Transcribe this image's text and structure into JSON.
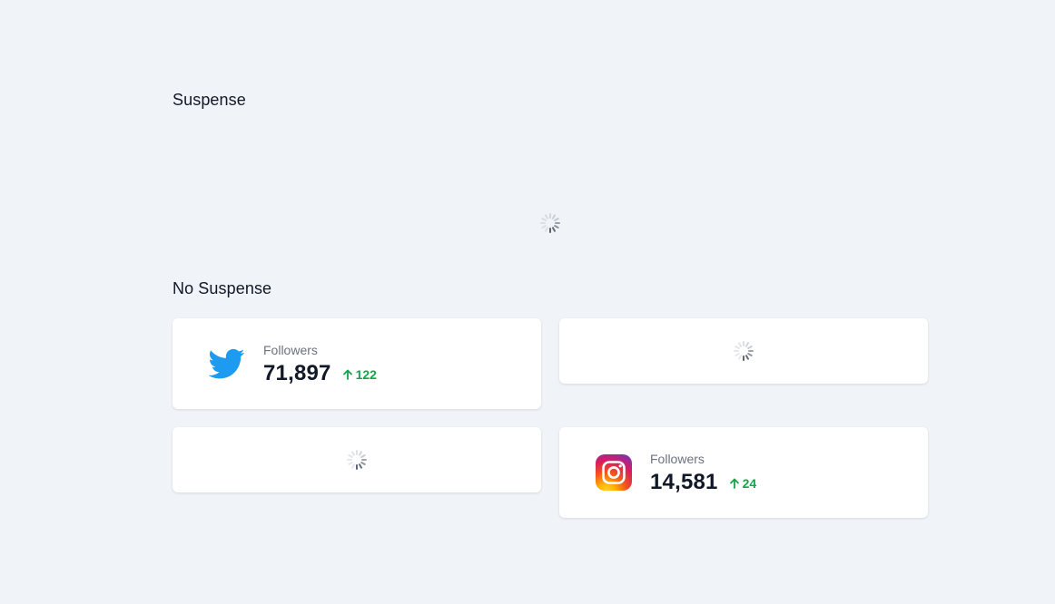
{
  "sections": {
    "suspense_title": "Suspense",
    "no_suspense_title": "No Suspense"
  },
  "cards": {
    "twitter": {
      "label": "Followers",
      "value": "71,897",
      "delta": "122",
      "icon": "twitter-icon"
    },
    "instagram": {
      "label": "Followers",
      "value": "14,581",
      "delta": "24",
      "icon": "instagram-icon"
    }
  },
  "colors": {
    "background": "#f0f4f8",
    "card": "#ffffff",
    "positive": "#16a34a",
    "twitter": "#1d9bf0"
  }
}
